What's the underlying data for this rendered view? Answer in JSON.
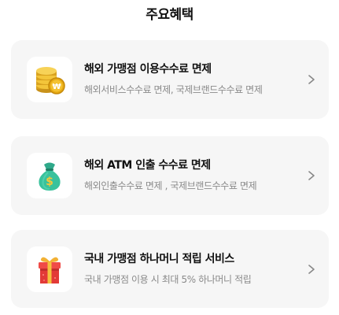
{
  "section": {
    "title": "주요혜택"
  },
  "benefits": [
    {
      "title": "해외 가맹점 이용수수료 면제",
      "description": "해외서비스수수료 면제, 국제브랜드수수료 면제",
      "icon": "coin-stack-icon"
    },
    {
      "title": "해외 ATM 인출 수수료 면제",
      "description": "해외인출수수료 면제 , 국제브랜드수수료 면제",
      "icon": "money-bag-icon"
    },
    {
      "title": "국내 가맹점 하나머니 적립 서비스",
      "description": "국내 가맹점 이용 시 최대 5% 하나머니 적립",
      "icon": "gift-box-icon"
    }
  ],
  "colors": {
    "card_background": "#f6f6f6",
    "title_text": "#111111",
    "description_text": "#8a8a8a"
  }
}
